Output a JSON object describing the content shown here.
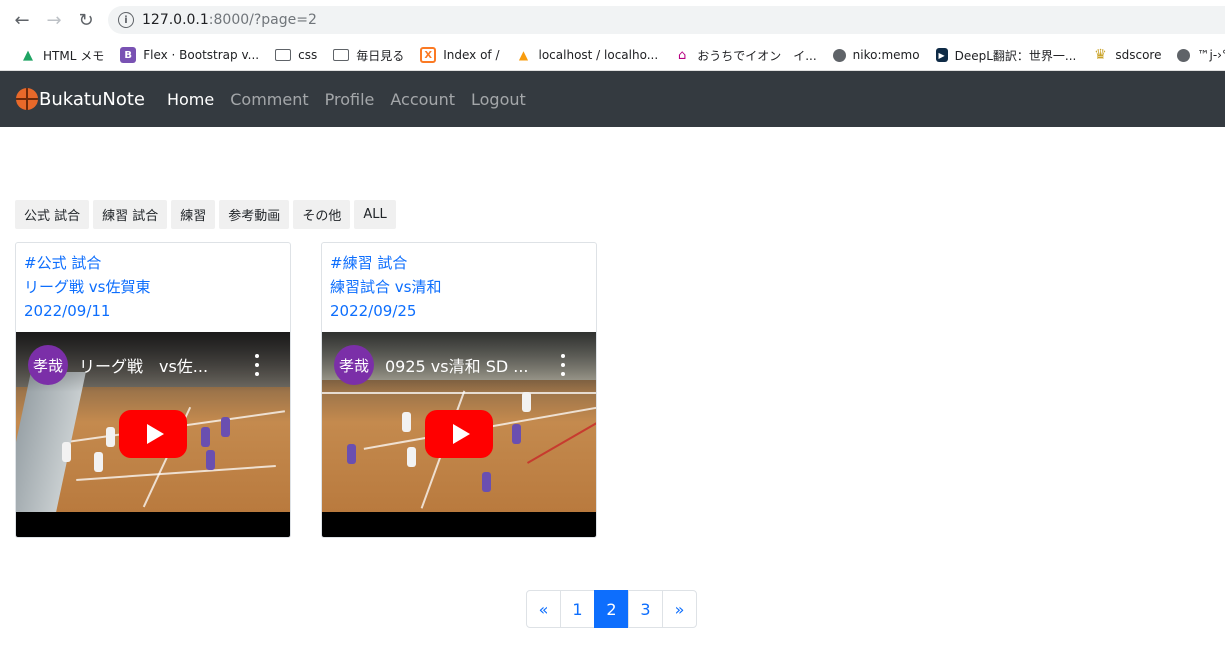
{
  "browser": {
    "url_host": "127.0.0.1",
    "url_path": ":8000/?page=2",
    "bookmarks": [
      {
        "label": "HTML メモ",
        "icon": "google-drive-icon",
        "color": "#1fa463"
      },
      {
        "label": "Flex · Bootstrap v...",
        "icon": "bootstrap-icon",
        "color": "#7952b3"
      },
      {
        "label": "css",
        "icon": "folder-icon",
        "color": "#5f6368"
      },
      {
        "label": "毎日見る",
        "icon": "folder-icon",
        "color": "#5f6368"
      },
      {
        "label": "Index of /",
        "icon": "xampp-icon",
        "color": "#fb7a24"
      },
      {
        "label": "localhost / localho...",
        "icon": "phpmyadmin-icon",
        "color": "#f89c0e"
      },
      {
        "label": "おうちでイオン　イ...",
        "icon": "aeon-house-icon",
        "color": "#b60081"
      },
      {
        "label": "niko:memo",
        "icon": "globe-icon",
        "color": "#5f6368"
      },
      {
        "label": "DeepL翻訳：世界一...",
        "icon": "deepl-icon",
        "color": "#0f2b46"
      },
      {
        "label": "sdscore",
        "icon": "sdscore-icon",
        "color": "#c9a227"
      },
      {
        "label": "™j-›°ŀ~*«",
        "icon": "globe-icon",
        "color": "#5f6368"
      }
    ]
  },
  "navbar": {
    "brand": "BukatuNote",
    "links": [
      "Home",
      "Comment",
      "Profile",
      "Account",
      "Logout"
    ]
  },
  "filters": [
    "公式 試合",
    "練習 試合",
    "練習",
    "参考動画",
    "その他",
    "ALL"
  ],
  "cards": [
    {
      "tag": "#公式 試合",
      "title": "リーグ戦 vs佐賀東",
      "date": "2022/09/11",
      "video": {
        "channel_initial": "孝哉",
        "title": "リーグ戦　vs佐..."
      }
    },
    {
      "tag": "#練習 試合",
      "title": "練習試合 vs清和",
      "date": "2022/09/25",
      "video": {
        "channel_initial": "孝哉",
        "title": "0925 vs清和 SD ..."
      }
    }
  ],
  "pagination": {
    "prev": "«",
    "pages": [
      "1",
      "2",
      "3"
    ],
    "current": "2",
    "next": "»"
  },
  "colors": {
    "navbar_bg": "#343a40",
    "link": "#0d6efd",
    "youtube_red": "#ff0000",
    "avatar": "#7b2fa8"
  }
}
